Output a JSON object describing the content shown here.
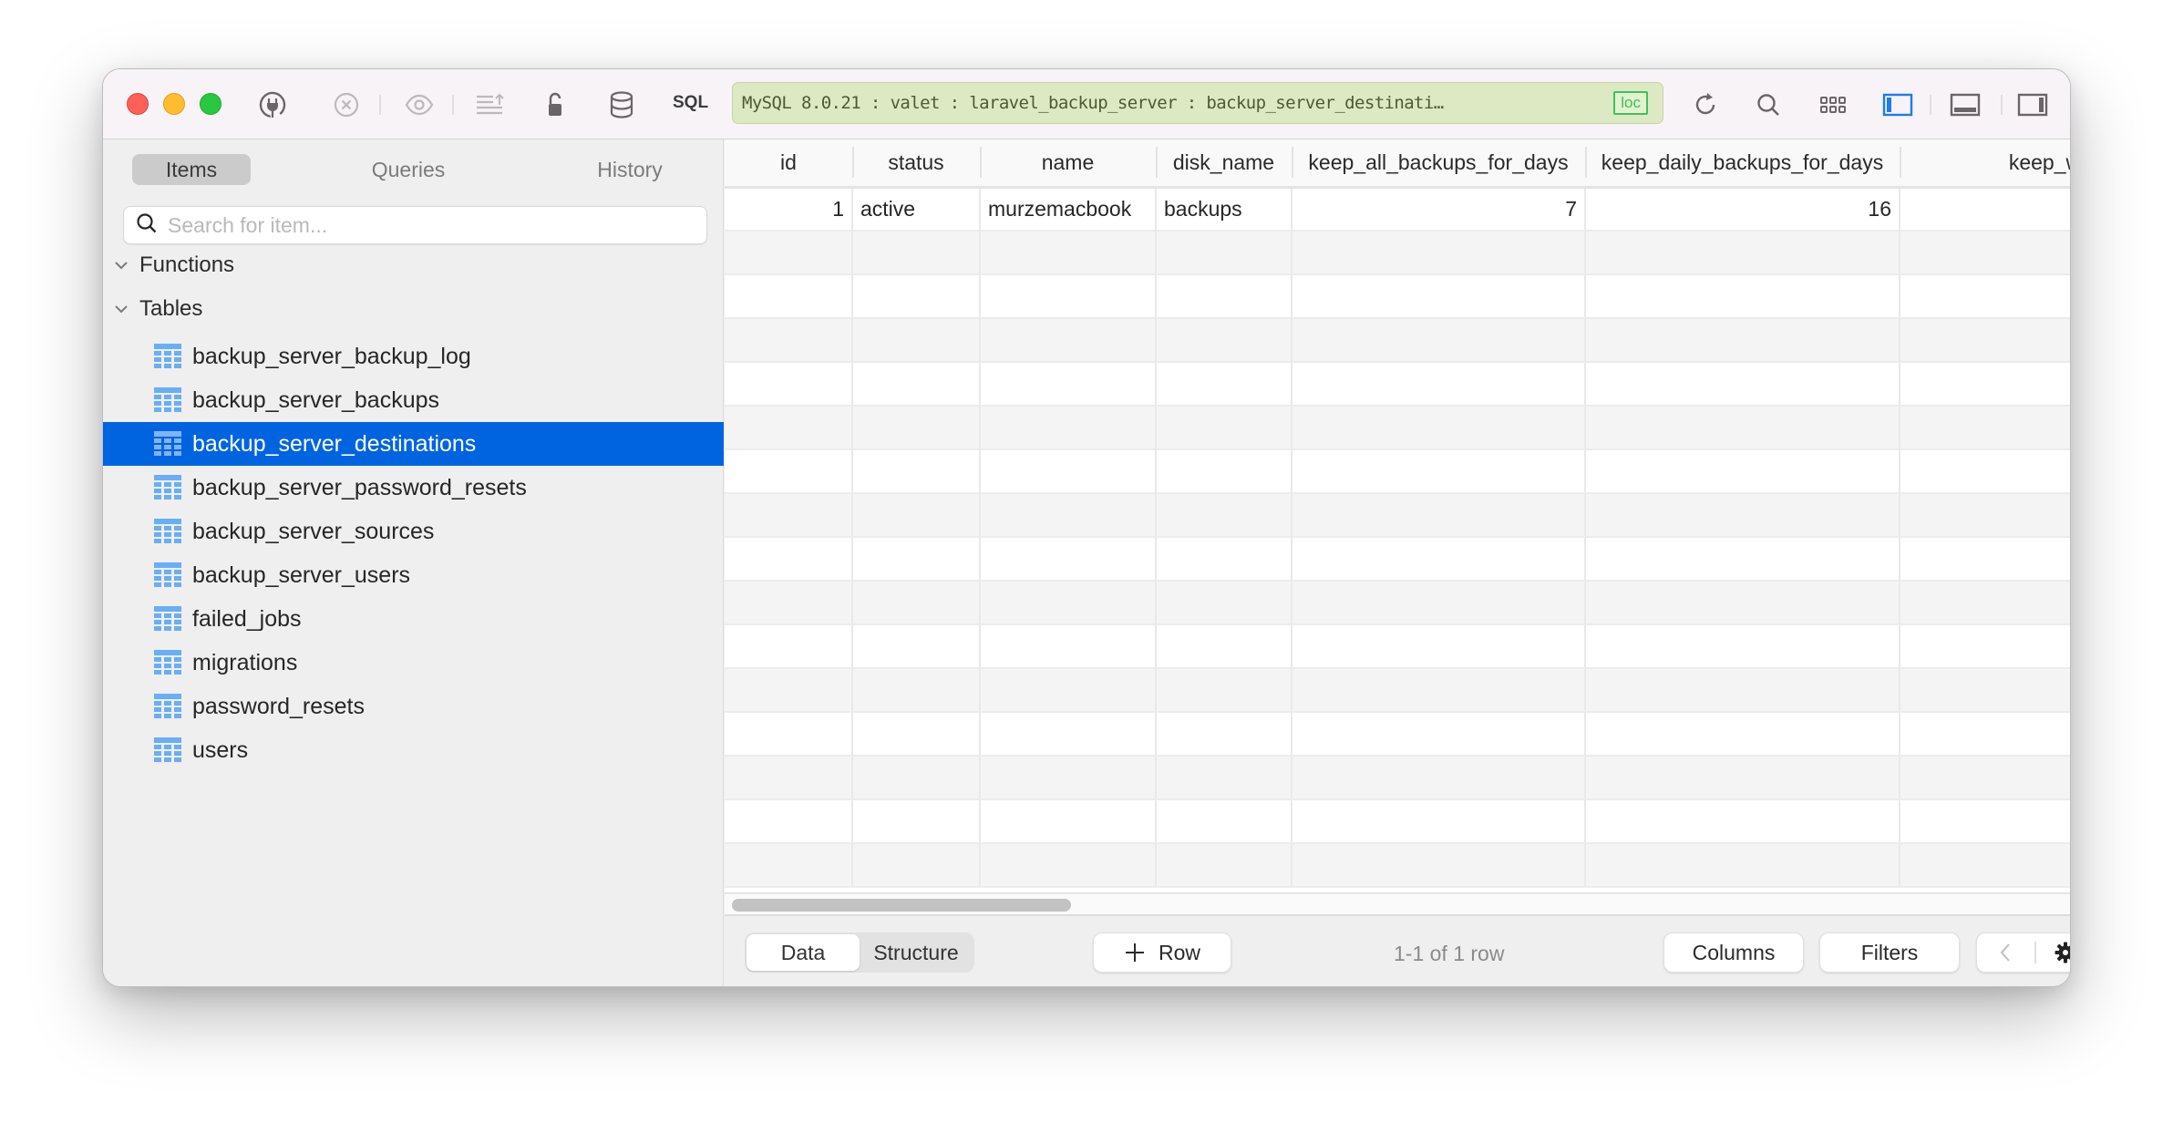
{
  "toolbar": {
    "window_controls": [
      "close",
      "minimize",
      "zoom"
    ],
    "icons": [
      "plug-icon",
      "stop-icon",
      "eye-icon",
      "export-icon",
      "lock-icon",
      "database-icon"
    ],
    "sql_label": "SQL",
    "connection_text": "MySQL 8.0.21 : valet : laravel_backup_server : backup_server_destinati…",
    "connection_badge": "loc",
    "right_icons": [
      "refresh-icon",
      "search-icon",
      "grid-icon",
      "toggle-sidebar-icon",
      "toggle-console-icon",
      "toggle-detail-icon"
    ],
    "colors": {
      "connection_bg": "#dde9c3",
      "badge": "#3cc25b",
      "accent": "#0064e1"
    }
  },
  "sidebar": {
    "tabs": [
      {
        "label": "Items",
        "active": true
      },
      {
        "label": "Queries",
        "active": false
      },
      {
        "label": "History",
        "active": false
      }
    ],
    "search": {
      "placeholder": "Search for item...",
      "value": ""
    },
    "groups": [
      {
        "label": "Functions",
        "expanded": true
      },
      {
        "label": "Tables",
        "expanded": true
      }
    ],
    "tables": [
      {
        "name": "backup_server_backup_log",
        "selected": false
      },
      {
        "name": "backup_server_backups",
        "selected": false
      },
      {
        "name": "backup_server_destinations",
        "selected": true
      },
      {
        "name": "backup_server_password_resets",
        "selected": false
      },
      {
        "name": "backup_server_sources",
        "selected": false
      },
      {
        "name": "backup_server_users",
        "selected": false
      },
      {
        "name": "failed_jobs",
        "selected": false
      },
      {
        "name": "migrations",
        "selected": false
      },
      {
        "name": "password_resets",
        "selected": false
      },
      {
        "name": "users",
        "selected": false
      }
    ]
  },
  "grid": {
    "columns": [
      "id",
      "status",
      "name",
      "disk_name",
      "keep_all_backups_for_days",
      "keep_daily_backups_for_days",
      "keep_weekly_ba"
    ],
    "rows": [
      [
        "1",
        "active",
        "murzemacbook",
        "backups",
        "7",
        "16",
        ""
      ]
    ]
  },
  "footer": {
    "view_tabs": [
      {
        "label": "Data",
        "active": true
      },
      {
        "label": "Structure",
        "active": false
      }
    ],
    "add_row_label": "Row",
    "row_count": "1-1 of 1 row",
    "columns_label": "Columns",
    "filters_label": "Filters"
  }
}
